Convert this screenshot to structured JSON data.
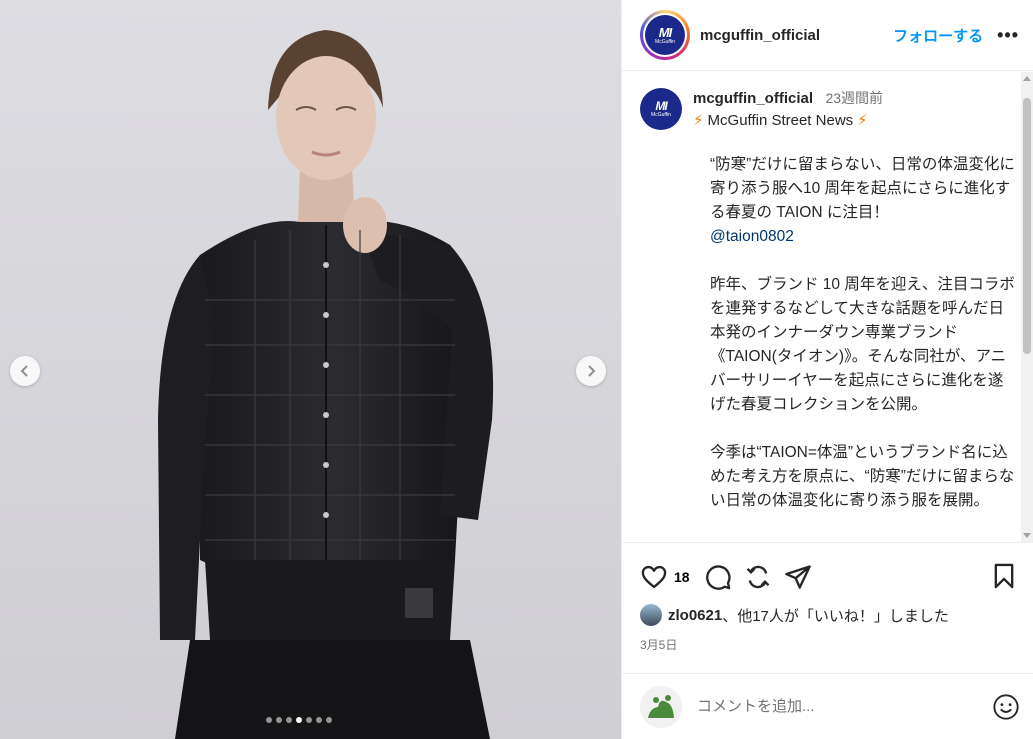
{
  "header": {
    "username": "mcguffin_official",
    "follow_label": "フォローする",
    "more_label": "•••",
    "avatar_text": "MI",
    "avatar_subtext": "McGuffin"
  },
  "caption": {
    "username": "mcguffin_official",
    "time": "23週間前",
    "title": "McGuffin Street News",
    "paragraph1": "“防寒”だけに留まらない、日常の体温変化に寄り添う服へ10 周年を起点にさらに進化する春夏の TAION に注目！",
    "mention": "@taion0802",
    "paragraph2": "昨年、ブランド 10 周年を迎え、注目コラボを連発するなどして大きな話題を呼んだ日本発のインナーダウン専業ブランド《TAION(タイオン)》。そんな同社が、アニバーサリーイヤーを起点にさらに進化を遂げた春夏コレクションを公開。",
    "paragraph3": "今季は“TAION=体温”というブランド名に込めた考え方を原点に、“防寒”だけに留まらない日常の体温変化に寄り添う服を展開。"
  },
  "actions": {
    "like_count": "18",
    "liked_by_user": "zlo0621",
    "liked_by_rest": "、他17人が「いいね！」しました",
    "date": "3月5日"
  },
  "comment": {
    "placeholder": "コメントを追加..."
  },
  "carousel": {
    "total": 7,
    "active_index": 3
  },
  "icons": [
    "chevron-left-icon",
    "chevron-right-icon",
    "heart-icon",
    "comment-icon",
    "repost-icon",
    "share-icon",
    "bookmark-icon",
    "emoji-icon",
    "lightning-icon"
  ],
  "colors": {
    "accent": "#0095f6",
    "brand_navy": "#1b2a8a",
    "mention": "#00376b",
    "bolt": "#f57c00"
  }
}
